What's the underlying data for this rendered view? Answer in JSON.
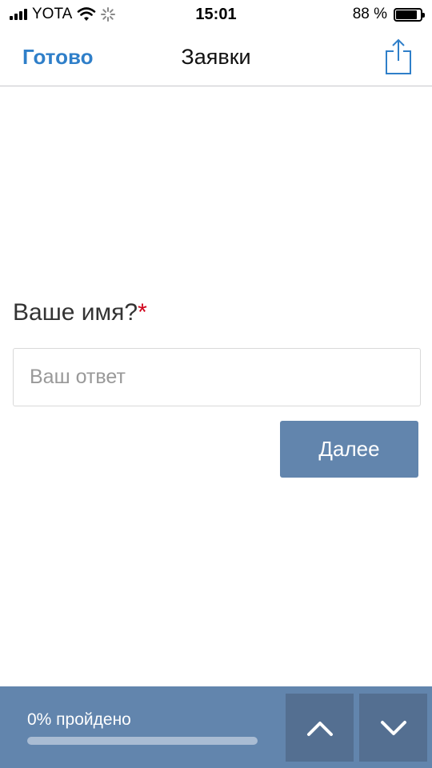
{
  "status_bar": {
    "carrier": "YOTA",
    "time": "15:01",
    "battery": "88 %",
    "battery_level": 0.88,
    "icons": [
      "signal-icon",
      "wifi-icon",
      "activity-spinner-icon",
      "battery-icon"
    ]
  },
  "nav": {
    "done_label": "Готово",
    "title": "Заявки",
    "share_icon": "share-icon"
  },
  "form": {
    "question": "Ваше имя?",
    "required_mark": "*",
    "answer_placeholder": "Ваш ответ",
    "answer_value": "",
    "next_label": "Далее"
  },
  "progress": {
    "label": "0% пройдено",
    "percent": 0,
    "up_icon": "chevron-up-icon",
    "down_icon": "chevron-down-icon"
  },
  "colors": {
    "accent": "#2f7fc9",
    "primary": "#6285ad",
    "primary_dark": "#546f91",
    "required": "#d0021b"
  }
}
